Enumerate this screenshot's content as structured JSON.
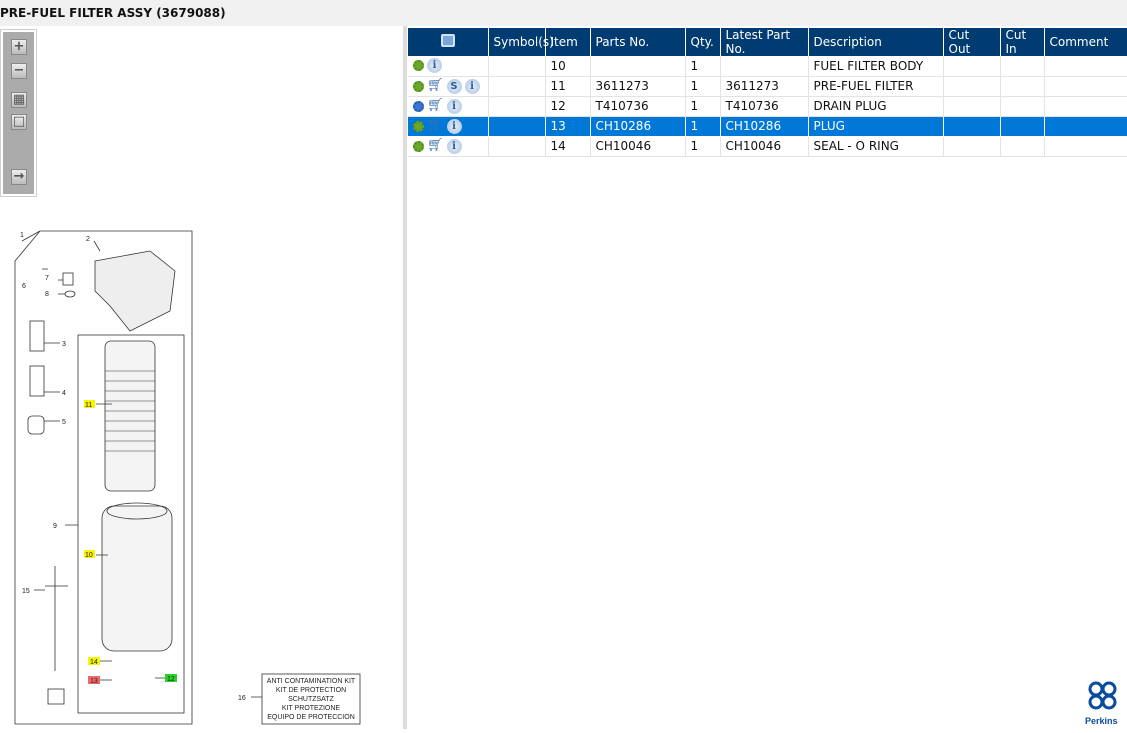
{
  "title": "PRE-FUEL FILTER ASSY (3679088)",
  "toolbar": {
    "zoom_in": "+",
    "zoom_out": "−"
  },
  "diagram": {
    "callouts": [
      "1",
      "2",
      "3",
      "4",
      "5",
      "6",
      "7",
      "8",
      "9",
      "10",
      "11",
      "12",
      "13",
      "14",
      "15",
      "16"
    ],
    "kit_text": [
      "ANTI CONTAMINATION KIT",
      "KIT DE PROTECTION",
      "SCHUTZSATZ",
      "KIT PROTEZIONE",
      "EQUIPO DE PROTECCION"
    ]
  },
  "table": {
    "headers": [
      "",
      "Symbol(s)",
      "Item",
      "Parts No.",
      "Qty.",
      "Latest Part No.",
      "Description",
      "Cut Out",
      "Cut In",
      "Comment"
    ],
    "rows": [
      {
        "icons": [
          "gear",
          "info"
        ],
        "item": "10",
        "part": "",
        "qty": "1",
        "latest": "",
        "desc": "FUEL FILTER BODY",
        "selected": false
      },
      {
        "icons": [
          "gear",
          "cart",
          "s",
          "info"
        ],
        "item": "11",
        "part": "3611273",
        "qty": "1",
        "latest": "3611273",
        "desc": "PRE-FUEL FILTER",
        "selected": false
      },
      {
        "icons": [
          "gears",
          "cart",
          "info"
        ],
        "item": "12",
        "part": "T410736",
        "qty": "1",
        "latest": "T410736",
        "desc": "DRAIN PLUG",
        "selected": false
      },
      {
        "icons": [
          "gear",
          "cart",
          "info"
        ],
        "item": "13",
        "part": "CH10286",
        "qty": "1",
        "latest": "CH10286",
        "desc": "PLUG",
        "selected": true
      },
      {
        "icons": [
          "gear",
          "cart",
          "info"
        ],
        "item": "14",
        "part": "CH10046",
        "qty": "1",
        "latest": "CH10046",
        "desc": "SEAL - O RING",
        "selected": false
      }
    ]
  },
  "logo": {
    "text": "Perkins",
    "color": "#0a4b9c"
  },
  "colors": {
    "header": "#003c71",
    "selected": "#0078d7"
  }
}
